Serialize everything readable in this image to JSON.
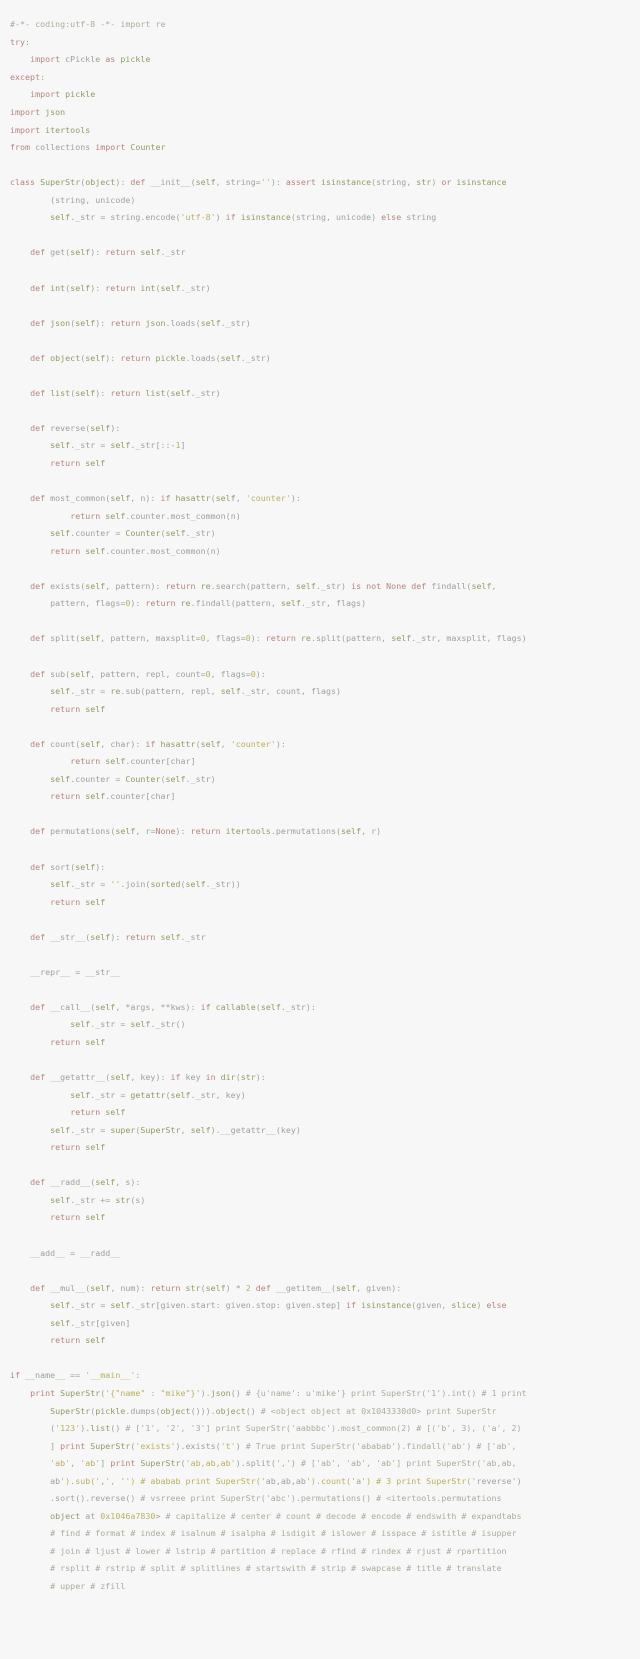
{
  "document": {
    "kind": "source-code-listing",
    "language": "Python",
    "background_color": "#f7f7f7",
    "default_text_color": "#9aa39a",
    "accent_colors": {
      "keyword": "#b5847c",
      "definition": "#8f9c63",
      "string": "#b9b05e",
      "identifier": "#79a3ad",
      "attribute": "#b3a95f",
      "comment": "#a8ad9c"
    }
  },
  "code": {
    "lines": [
      "#-*- coding:utf-8 -*- import re",
      "try:",
      "    import cPickle as pickle",
      "except:",
      "    import pickle",
      "import json",
      "import itertools",
      "from collections import Counter",
      "",
      "class SuperStr(object): def __init__(self, string=''): assert isinstance(string, str) or isinstance",
      "        (string, unicode)",
      "        self._str = string.encode('utf-8') if isinstance(string, unicode) else string",
      "",
      "    def get(self): return self._str",
      "",
      "    def int(self): return int(self._str)",
      "",
      "    def json(self): return json.loads(self._str)",
      "",
      "    def object(self): return pickle.loads(self._str)",
      "",
      "    def list(self): return list(self._str)",
      "",
      "    def reverse(self):",
      "        self._str = self._str[::-1]",
      "        return self",
      "",
      "    def most_common(self, n): if hasattr(self, 'counter'):",
      "            return self.counter.most_common(n)",
      "        self.counter = Counter(self._str)",
      "        return self.counter.most_common(n)",
      "",
      "    def exists(self, pattern): return re.search(pattern, self._str) is not None def findall(self,",
      "        pattern, flags=0): return re.findall(pattern, self._str, flags)",
      "",
      "    def split(self, pattern, maxsplit=0, flags=0): return re.split(pattern, self._str, maxsplit, flags)",
      "",
      "    def sub(self, pattern, repl, count=0, flags=0):",
      "        self._str = re.sub(pattern, repl, self._str, count, flags)",
      "        return self",
      "",
      "    def count(self, char): if hasattr(self, 'counter'):",
      "            return self.counter[char]",
      "        self.counter = Counter(self._str)",
      "        return self.counter[char]",
      "",
      "    def permutations(self, r=None): return itertools.permutations(self, r)",
      "",
      "    def sort(self):",
      "        self._str = ''.join(sorted(self._str))",
      "        return self",
      "",
      "    def __str__(self): return self._str",
      "",
      "    __repr__ = __str__",
      "",
      "    def __call__(self, *args, **kws): if callable(self._str):",
      "            self._str = self._str()",
      "        return self",
      "",
      "    def __getattr__(self, key): if key in dir(str):",
      "            self._str = getattr(self._str, key)",
      "            return self",
      "        self._str = super(SuperStr, self).__getattr__(key)",
      "        return self",
      "",
      "    def __radd__(self, s):",
      "        self._str += str(s)",
      "        return self",
      "",
      "    __add__ = __radd__",
      "",
      "    def __mul__(self, num): return str(self) * 2 def __getitem__(self, given):",
      "        self._str = self._str[given.start: given.stop: given.step] if isinstance(given, slice) else",
      "        self._str[given]",
      "        return self",
      "",
      "if __name__ == '__main__':",
      "    print SuperStr('{\"name\" : \"mike\"}').json() # {u'name': u'mike'} print SuperStr('1').int() # 1 print",
      "        SuperStr(pickle.dumps(object())).object() # <object object at 0x1043330d0> print SuperStr",
      "        ('123').list() # ['1', '2', '3'] print SuperStr('aabbbc').most_common(2) # [('b', 3), ('a', 2)",
      "        ] print SuperStr('exists').exists('t') # True print SuperStr('ababab').findall('ab') # ['ab',",
      "        'ab', 'ab'] print SuperStr('ab,ab,ab').split(',') # ['ab', 'ab', 'ab'] print SuperStr('ab,ab,",
      "        ab').sub(',', '') # ababab print SuperStr('ab,ab,ab').count('a') # 3 print SuperStr('reverse')",
      "        .sort().reverse() # vsrreee print SuperStr('abc').permutations() # <itertools.permutations",
      "        object at 0x1046a7830> # capitalize # center # count # decode # encode # endswith # expandtabs",
      "        # find # format # index # isalnum # isalpha # isdigit # islower # isspace # istitle # isupper",
      "        # join # ljust # lower # lstrip # partition # replace # rfind # rindex # rjust # rpartition",
      "        # rsplit # rstrip # split # splitlines # startswith # strip # swapcase # title # translate",
      "        # upper # zfill"
    ]
  }
}
